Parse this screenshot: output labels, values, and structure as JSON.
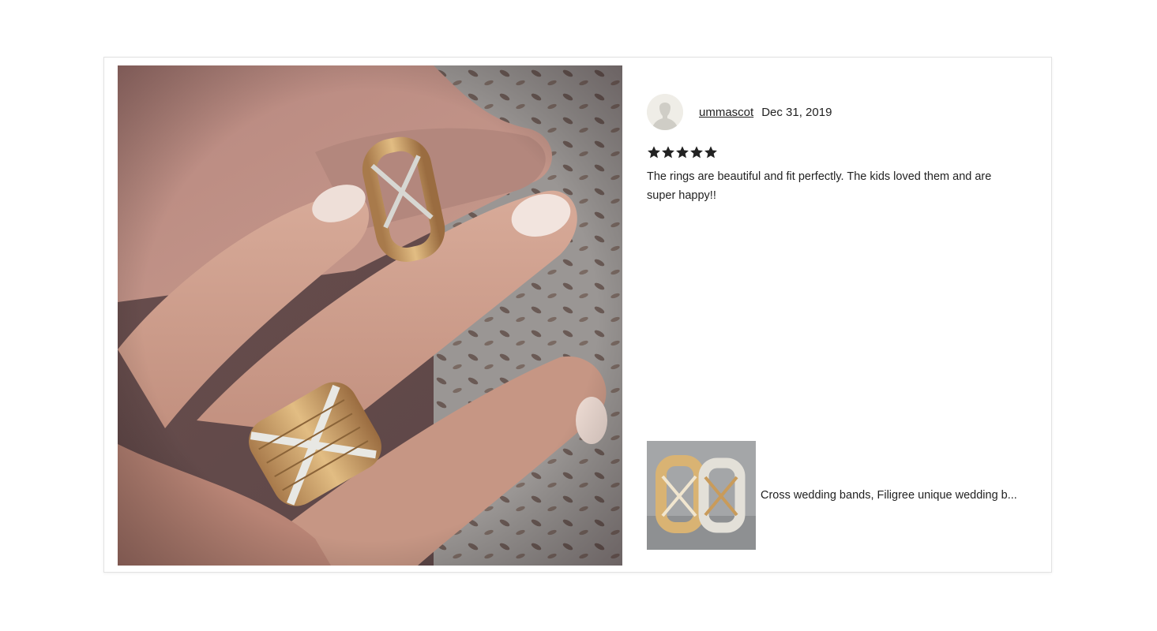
{
  "review": {
    "reviewer_name": "ummascot",
    "date": "Dec 31, 2019",
    "rating": 5,
    "rating_max": 5,
    "text": "The rings are beautiful and fit perfectly. The kids loved them and are super happy!!"
  },
  "product": {
    "title": "Cross wedding bands, Filigree unique wedding b..."
  },
  "icons": {
    "star": "star-icon",
    "avatar": "default-avatar-icon"
  },
  "colors": {
    "text": "#222222",
    "star": "#222222",
    "border": "#e2e2e2"
  }
}
